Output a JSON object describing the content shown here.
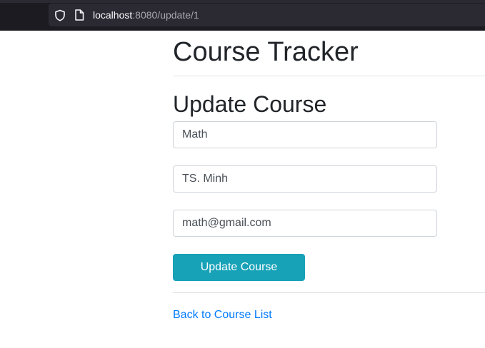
{
  "browser": {
    "url_host": "localhost",
    "url_rest": ":8080/update/1",
    "icons": [
      "shield-icon",
      "page-icon"
    ]
  },
  "page": {
    "app_title": "Course Tracker",
    "form_title": "Update Course",
    "fields": {
      "name": "Math",
      "instructor": "TS. Minh",
      "email": "math@gmail.com"
    },
    "submit_label": "Update Course",
    "back_link": "Back to Course List"
  },
  "colors": {
    "button": "#17a2b8",
    "link": "#007bff",
    "browser_bar": "#1c1b22"
  }
}
